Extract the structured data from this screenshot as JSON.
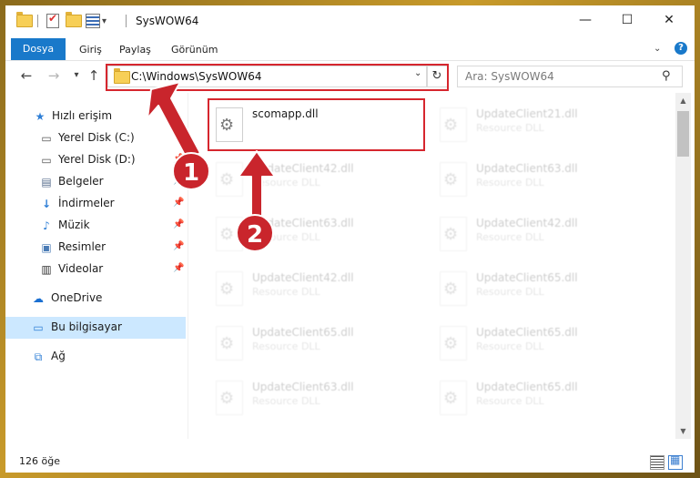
{
  "window": {
    "title": "SysWOW64",
    "controls": {
      "minimize": "—",
      "maximize": "☐",
      "close": "✕"
    }
  },
  "ribbon": {
    "tabs": [
      "Dosya",
      "Giriş",
      "Paylaş",
      "Görünüm"
    ],
    "help": "?"
  },
  "address": {
    "path": "C:\\Windows\\SysWOW64",
    "dropdown_icon": "chevron-down-icon",
    "refresh_icon": "refresh-icon"
  },
  "search": {
    "placeholder": "Ara: SysWOW64",
    "icon": "search-icon"
  },
  "nav_pane": {
    "items": [
      {
        "label": "Hızlı erişim",
        "icon": "star-icon",
        "pinned": false
      },
      {
        "label": "Yerel Disk (C:)",
        "icon": "drive-icon",
        "pinned": false
      },
      {
        "label": "Yerel Disk (D:)",
        "icon": "drive-icon",
        "pinned": true
      },
      {
        "label": "Belgeler",
        "icon": "documents-icon",
        "pinned": true
      },
      {
        "label": "İndirmeler",
        "icon": "download-icon",
        "pinned": true
      },
      {
        "label": "Müzik",
        "icon": "music-icon",
        "pinned": true
      },
      {
        "label": "Resimler",
        "icon": "pictures-icon",
        "pinned": true
      },
      {
        "label": "Videolar",
        "icon": "video-icon",
        "pinned": true
      },
      {
        "label": "OneDrive",
        "icon": "cloud-icon",
        "pinned": false
      },
      {
        "label": "Bu bilgisayar",
        "icon": "computer-icon",
        "pinned": false,
        "selected": true
      },
      {
        "label": "Ağ",
        "icon": "network-icon",
        "pinned": false
      }
    ]
  },
  "files": [
    {
      "name": "scomapp.dll",
      "type": "",
      "highlighted": true
    },
    {
      "name": "UpdateClient21.dll",
      "type": "Resource DLL"
    },
    {
      "name": "UpdateClient42.dll",
      "type": "Resource DLL"
    },
    {
      "name": "UpdateClient63.dll",
      "type": "Resource DLL"
    },
    {
      "name": "UpdateClient63.dll",
      "type": "Resource DLL"
    },
    {
      "name": "UpdateClient42.dll",
      "type": "Resource DLL"
    },
    {
      "name": "UpdateClient42.dll",
      "type": "Resource DLL"
    },
    {
      "name": "UpdateClient65.dll",
      "type": "Resource DLL"
    },
    {
      "name": "UpdateClient65.dll",
      "type": "Resource DLL"
    },
    {
      "name": "UpdateClient65.dll",
      "type": "Resource DLL"
    },
    {
      "name": "UpdateClient63.dll",
      "type": "Resource DLL"
    },
    {
      "name": "UpdateClient65.dll",
      "type": "Resource DLL"
    }
  ],
  "status": {
    "item_count": "126 öğe"
  },
  "annotations": [
    {
      "label": "1"
    },
    {
      "label": "2"
    }
  ],
  "colors": {
    "accent": "#1979ca",
    "annotation": "#c9252c",
    "selection": "#cce8ff"
  }
}
